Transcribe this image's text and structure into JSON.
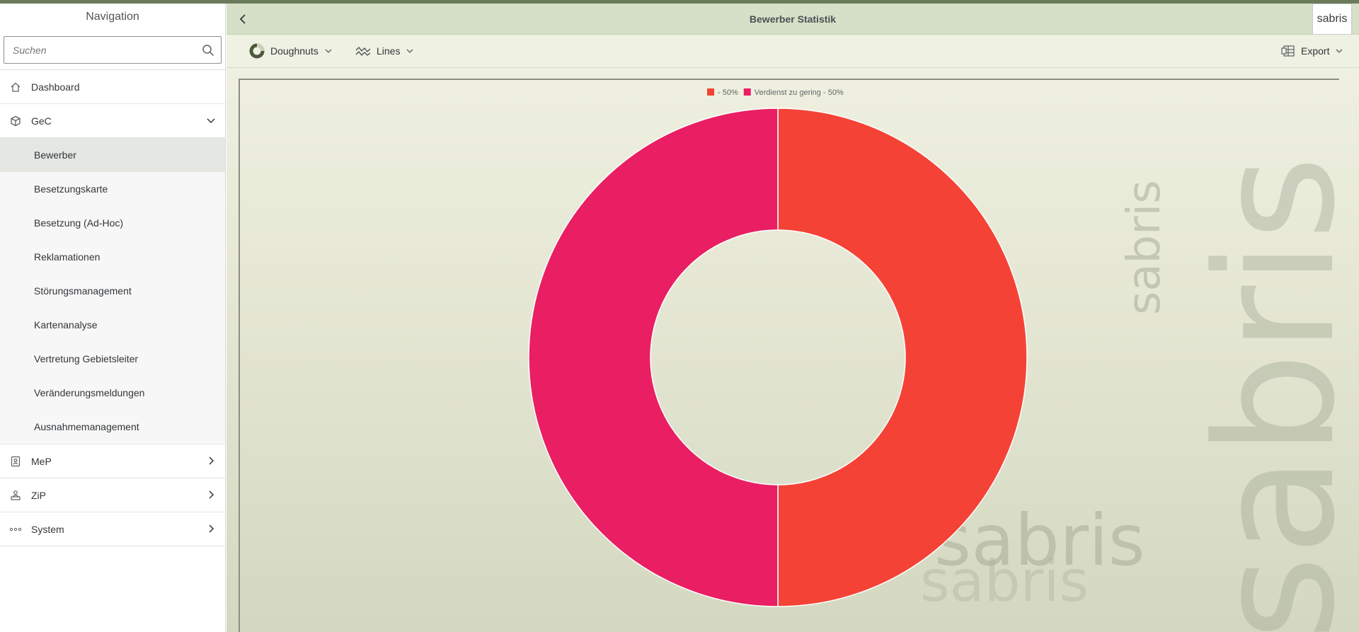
{
  "navigation": {
    "title": "Navigation",
    "search_placeholder": "Suchen",
    "items": [
      {
        "label": "Dashboard",
        "icon": "home-icon"
      },
      {
        "label": "GeC",
        "icon": "cube-icon",
        "expanded": true
      },
      {
        "label": "MeP",
        "icon": "contact-card-icon"
      },
      {
        "label": "ZiP",
        "icon": "person-desk-icon"
      },
      {
        "label": "System",
        "icon": "more-dots-icon"
      }
    ],
    "gec_subitems": [
      {
        "label": "Bewerber",
        "selected": true
      },
      {
        "label": "Besetzungskarte"
      },
      {
        "label": "Besetzung (Ad-Hoc)"
      },
      {
        "label": "Reklamationen"
      },
      {
        "label": "Störungsmanagement"
      },
      {
        "label": "Kartenanalyse"
      },
      {
        "label": "Vertretung Gebietsleiter"
      },
      {
        "label": "Veränderungsmeldungen"
      },
      {
        "label": "Ausnahmemanagement"
      }
    ]
  },
  "header": {
    "title": "Bewerber Statistik",
    "logo_text": "sabris"
  },
  "toolbar": {
    "chart_type_label": "Doughnuts",
    "line_type_label": "Lines",
    "export_label": "Export"
  },
  "watermark": {
    "text": "sabris"
  },
  "chart_data": {
    "type": "pie",
    "donut": true,
    "legend_position": "top",
    "series": [
      {
        "legend_label": " - 50%",
        "value": 50,
        "color": "#f44336"
      },
      {
        "legend_label": "Verdienst zu gering - 50%",
        "value": 50,
        "color": "#e91e63"
      }
    ]
  },
  "colors": {
    "header_bg": "#d5e0c6",
    "toolbar_bg": "#eff1e2",
    "selected_nav_bg": "#e5e7e3"
  }
}
